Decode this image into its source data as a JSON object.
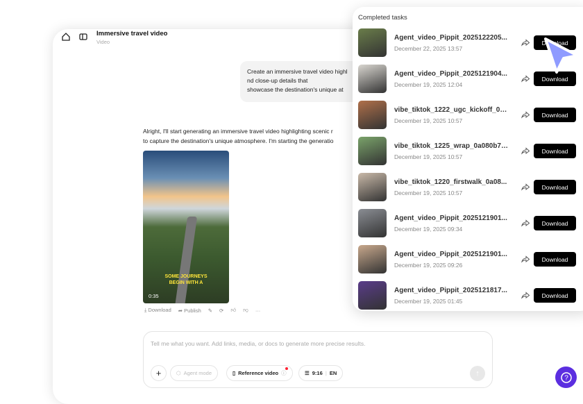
{
  "header": {
    "title": "Immersive travel video",
    "subtitle": "Video"
  },
  "chat": {
    "user_message": [
      "Create an immersive travel video highl",
      "nd close-up details that",
      "showcase the destination's unique at"
    ],
    "reply": [
      "Alright, I'll start generating an immersive travel video highlighting scenic r",
      "to capture the destination's unique atmosphere. I'm starting the generatio"
    ],
    "video": {
      "caption": [
        "SOME JOURNEYS",
        "BEGIN WITH A"
      ],
      "duration": "0:35"
    },
    "actions": {
      "download": "Download",
      "publish": "Publish"
    }
  },
  "composer": {
    "placeholder": "Tell me what you want. Add links, media, or docs to generate more precise results.",
    "agent_mode": "Agent mode",
    "reference_video": "Reference video",
    "ratio": "9:16",
    "language": "EN"
  },
  "panel": {
    "title": "Completed tasks",
    "download_label": "Download",
    "items": [
      {
        "name": "Agent_video_Pippit_2025122205...",
        "date": "December 22, 2025 13:57",
        "color": "#6a7d4a"
      },
      {
        "name": "Agent_video_Pippit_2025121904...",
        "date": "December 19, 2025 12:04",
        "color": "#d9d6d0"
      },
      {
        "name": "vibe_tiktok_1222_ugc_kickoff_0a...",
        "date": "December 19, 2025 10:57",
        "color": "#b0704a"
      },
      {
        "name": "vibe_tiktok_1225_wrap_0a080b7d...",
        "date": "December 19, 2025 10:57",
        "color": "#7aa36a"
      },
      {
        "name": "vibe_tiktok_1220_firstwalk_0a08...",
        "date": "December 19, 2025 10:57",
        "color": "#c9b9a8"
      },
      {
        "name": "Agent_video_Pippit_2025121901...",
        "date": "December 19, 2025 09:34",
        "color": "#8a8d93"
      },
      {
        "name": "Agent_video_Pippit_2025121901...",
        "date": "December 19, 2025 09:26",
        "color": "#c8a88c"
      },
      {
        "name": "Agent_video_Pippit_2025121817...",
        "date": "December 19, 2025 01:45",
        "color": "#5a3c8a"
      }
    ]
  }
}
